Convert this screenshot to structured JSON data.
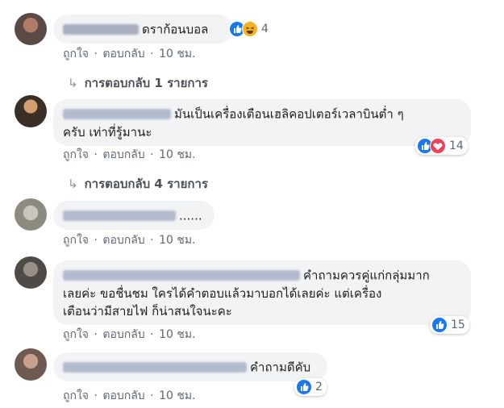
{
  "comments": [
    {
      "text": "ดราก้อนบอล",
      "actions": {
        "like": "ถูกใจ",
        "reply": "ตอบกลับ",
        "time": "10 ชม."
      },
      "reaction_count": "4",
      "replies_label": "การตอบกลับ 1 รายการ"
    },
    {
      "text_line1": "มันเป็นเครื่องเตือนเฮลิคอปเตอร์เวลาบินต่ำ ๆ",
      "text_line2": "ครับ เท่าที่รู้มานะ",
      "actions": {
        "like": "ถูกใจ",
        "reply": "ตอบกลับ",
        "time": "10 ชม."
      },
      "reaction_count": "14",
      "replies_label": "การตอบกลับ 4 รายการ"
    },
    {
      "text": "......",
      "actions": {
        "like": "ถูกใจ",
        "reply": "ตอบกลับ",
        "time": "10 ชม."
      }
    },
    {
      "text_line1": "คำถามควรคู่แก่กลุ่มมาก",
      "text_line2": "เลยค่ะ ขอชื่นชม ใครได้คำตอบแล้วมาบอกได้เลยค่ะ แต่เครื่อง",
      "text_line3": "เตือนว่ามีสายไฟ ก็น่าสนใจนะคะ",
      "actions": {
        "like": "ถูกใจ",
        "reply": "ตอบกลับ",
        "time": "10 ชม."
      },
      "reaction_count": "15"
    },
    {
      "text": "คำถามดีคับ",
      "actions": {
        "like": "ถูกใจ",
        "reply": "ตอบกลับ",
        "time": "10 ชม."
      },
      "reaction_count": "2"
    }
  ],
  "icons": {
    "like": "like-reaction-icon",
    "haha": "haha-reaction-icon",
    "love": "love-reaction-icon",
    "reply_arrow": "reply-arrow-icon"
  },
  "colors": {
    "bubble": "#f2f3f5",
    "like_blue": "#1877f2",
    "love_red": "#f33e58",
    "haha_yellow": "#f7b125",
    "meta_text": "#606770"
  }
}
